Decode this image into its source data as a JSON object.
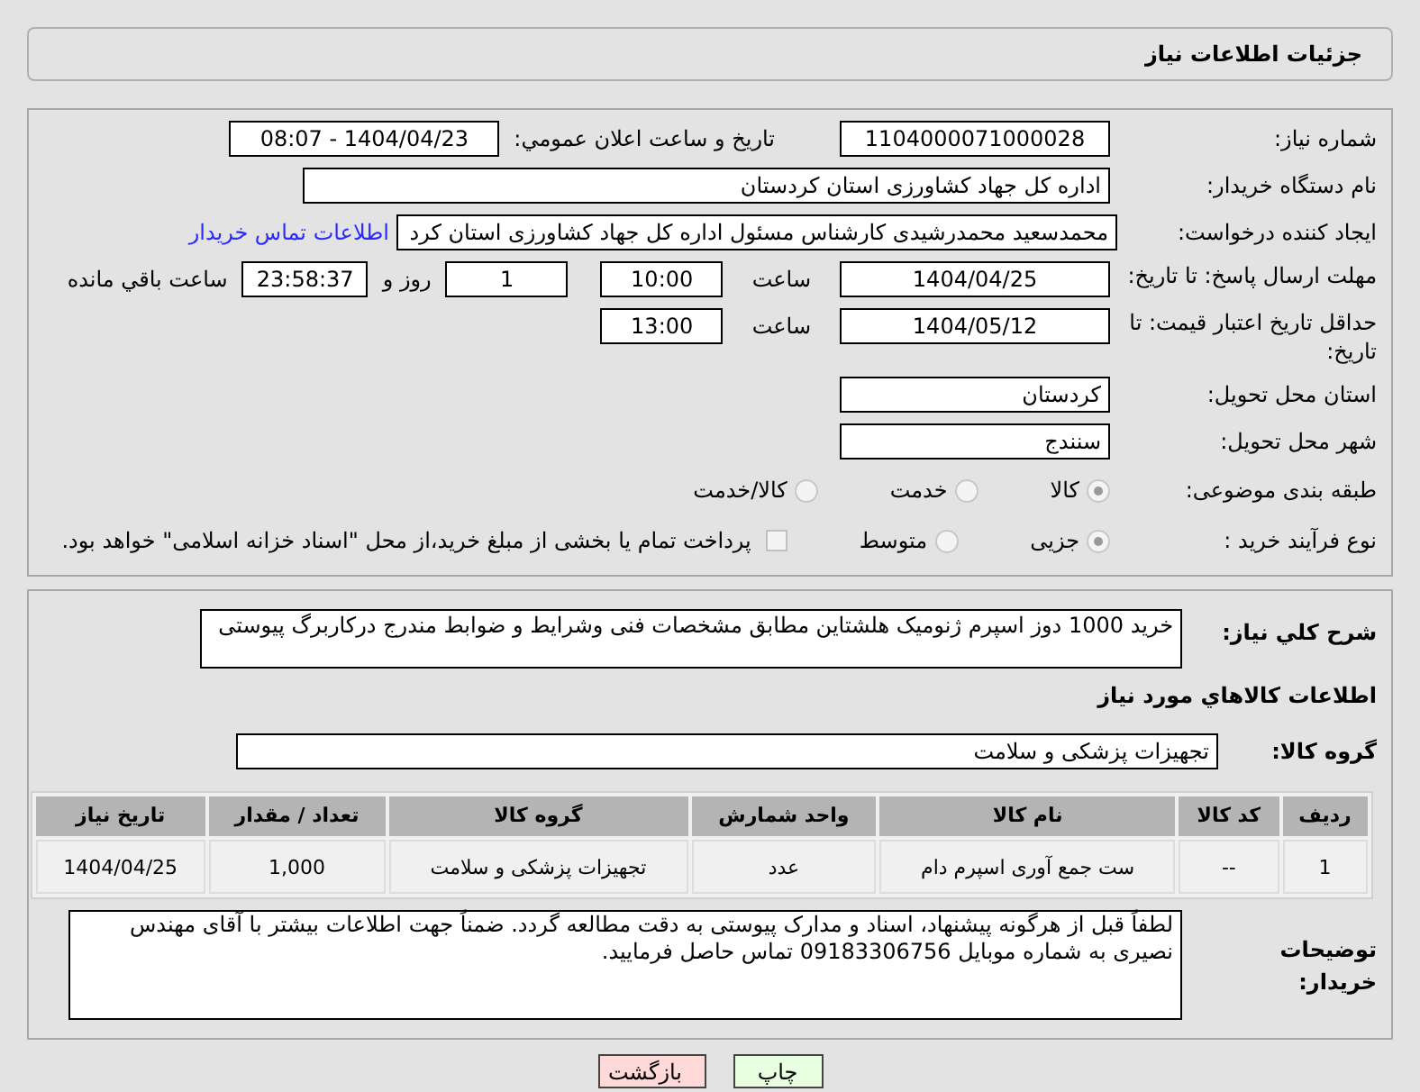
{
  "page_title": "جزئیات اطلاعات نیاز",
  "need_number": {
    "label": "شماره نیاز:",
    "value": "1104000071000028"
  },
  "announce": {
    "label": "تاریخ و ساعت اعلان عمومي:",
    "value": "1404/04/23 - 08:07"
  },
  "buyer": {
    "label": "نام دستگاه خریدار:",
    "value": "اداره کل جهاد کشاورزی استان کردستان"
  },
  "creator": {
    "label": "ایجاد کننده درخواست:",
    "value": "محمدسعید محمدرشیدی کارشناس مسئول اداره کل جهاد کشاورزی استان کرد",
    "link": "اطلاعات تماس خریدار"
  },
  "deadline": {
    "label": "مهلت ارسال پاسخ: تا تاریخ:",
    "date": "1404/04/25",
    "time_label": "ساعت",
    "time": "10:00",
    "days": "1",
    "days_label": "روز و",
    "remaining": "23:58:37",
    "remaining_label": "ساعت باقي مانده"
  },
  "validity": {
    "label": "حداقل تاریخ اعتبار قیمت: تا تاریخ:",
    "date": "1404/05/12",
    "time_label": "ساعت",
    "time": "13:00"
  },
  "province": {
    "label": "استان محل تحویل:",
    "value": "کردستان"
  },
  "city": {
    "label": "شهر محل تحویل:",
    "value": "سنندج"
  },
  "category": {
    "label": "طبقه بندی موضوعی:",
    "options": [
      {
        "label": "کالا",
        "selected": true
      },
      {
        "label": "خدمت",
        "selected": false
      },
      {
        "label": "کالا/خدمت",
        "selected": false
      }
    ]
  },
  "process": {
    "label": "نوع فرآیند خرید :",
    "options": [
      {
        "label": "جزیی",
        "selected": true
      },
      {
        "label": "متوسط",
        "selected": false
      }
    ],
    "payment": {
      "checked": false,
      "label": "پرداخت تمام یا بخشی از مبلغ خرید،از محل \"اسناد خزانه اسلامی\" خواهد بود."
    }
  },
  "description": {
    "label": "شرح کلي نیاز:",
    "value": "خرید 1000 دوز اسپرم ژنومیک هلشتاین مطابق مشخصات فنی وشرایط و ضوابط مندرج درکاربرگ پیوستی"
  },
  "goods_heading": "اطلاعات کالاهاي مورد نیاز",
  "goods_group": {
    "label": "گروه کالا:",
    "value": "تجهیزات پزشکی و سلامت"
  },
  "table": {
    "columns": [
      "ردیف",
      "کد کالا",
      "نام کالا",
      "واحد شمارش",
      "گروه کالا",
      "تعداد / مقدار",
      "تاریخ نیاز"
    ],
    "rows": [
      [
        "1",
        "--",
        "ست جمع آوری اسپرم دام",
        "عدد",
        "تجهیزات پزشکی و سلامت",
        "1,000",
        "1404/04/25"
      ]
    ]
  },
  "notes": {
    "label": "توضیحات خریدار:",
    "value": "لطفاً قبل از هرگونه پیشنهاد، اسناد و مدارک پیوستی به دقت مطالعه گردد. ضمناً جهت اطلاعات بیشتر با آقای مهندس نصیری  به شماره موبایل   09183306756 تماس حاصل فرمایید."
  },
  "buttons": [
    {
      "label": "چاپ",
      "kind": "print"
    },
    {
      "label": "بازگشت",
      "kind": "back"
    }
  ]
}
